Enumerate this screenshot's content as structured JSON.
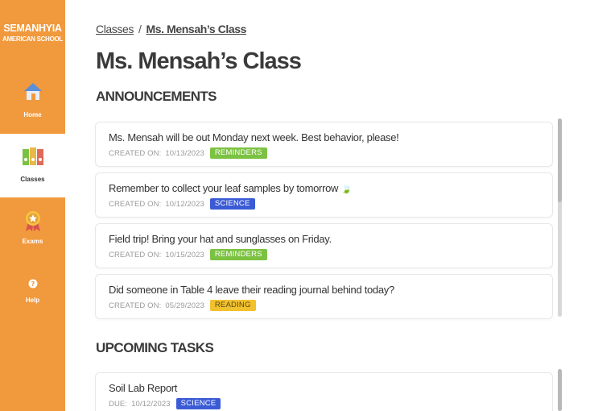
{
  "school": {
    "name_line1": "SEMANHYIA",
    "name_line2": "AMERICAN SCHOOL"
  },
  "nav": [
    {
      "label": "Home",
      "icon": "house-icon"
    },
    {
      "label": "Classes",
      "icon": "binders-icon",
      "active": true
    },
    {
      "label": "Exams",
      "icon": "medal-icon"
    },
    {
      "label": "Help",
      "icon": "question-icon"
    }
  ],
  "breadcrumb": {
    "parent": "Classes",
    "separator": "/",
    "current": "Ms. Mensah’s Class"
  },
  "page_title": "Ms. Mensah’s Class",
  "announcements": {
    "heading": "ANNOUNCEMENTS",
    "created_label": "CREATED ON:",
    "items": [
      {
        "text": "Ms. Mensah will be out Monday next week. Best behavior, please!",
        "date": "10/13/2023",
        "tag": "REMINDERS",
        "tag_color": "#7cc242"
      },
      {
        "text": "Remember to collect your leaf samples by tomorrow",
        "emoji": "🍃",
        "date": "10/12/2023",
        "tag": "SCIENCE",
        "tag_color": "#3b5bd6"
      },
      {
        "text": "Field trip! Bring your hat and sunglasses on Friday.",
        "date": "10/15/2023",
        "tag": "REMINDERS",
        "tag_color": "#7cc242"
      },
      {
        "text": "Did someone in Table 4 leave their reading journal behind today?",
        "date": "05/29/2023",
        "tag": "READING",
        "tag_color": "#f2c12e"
      }
    ]
  },
  "tasks": {
    "heading": "UPCOMING TASKS",
    "due_label": "DUE:",
    "items": [
      {
        "text": "Soil Lab Report",
        "date": "10/12/2023",
        "tag": "SCIENCE",
        "tag_color": "#3b5bd6"
      }
    ]
  },
  "colors": {
    "sidebar": "#f0993d",
    "text": "#333333"
  }
}
